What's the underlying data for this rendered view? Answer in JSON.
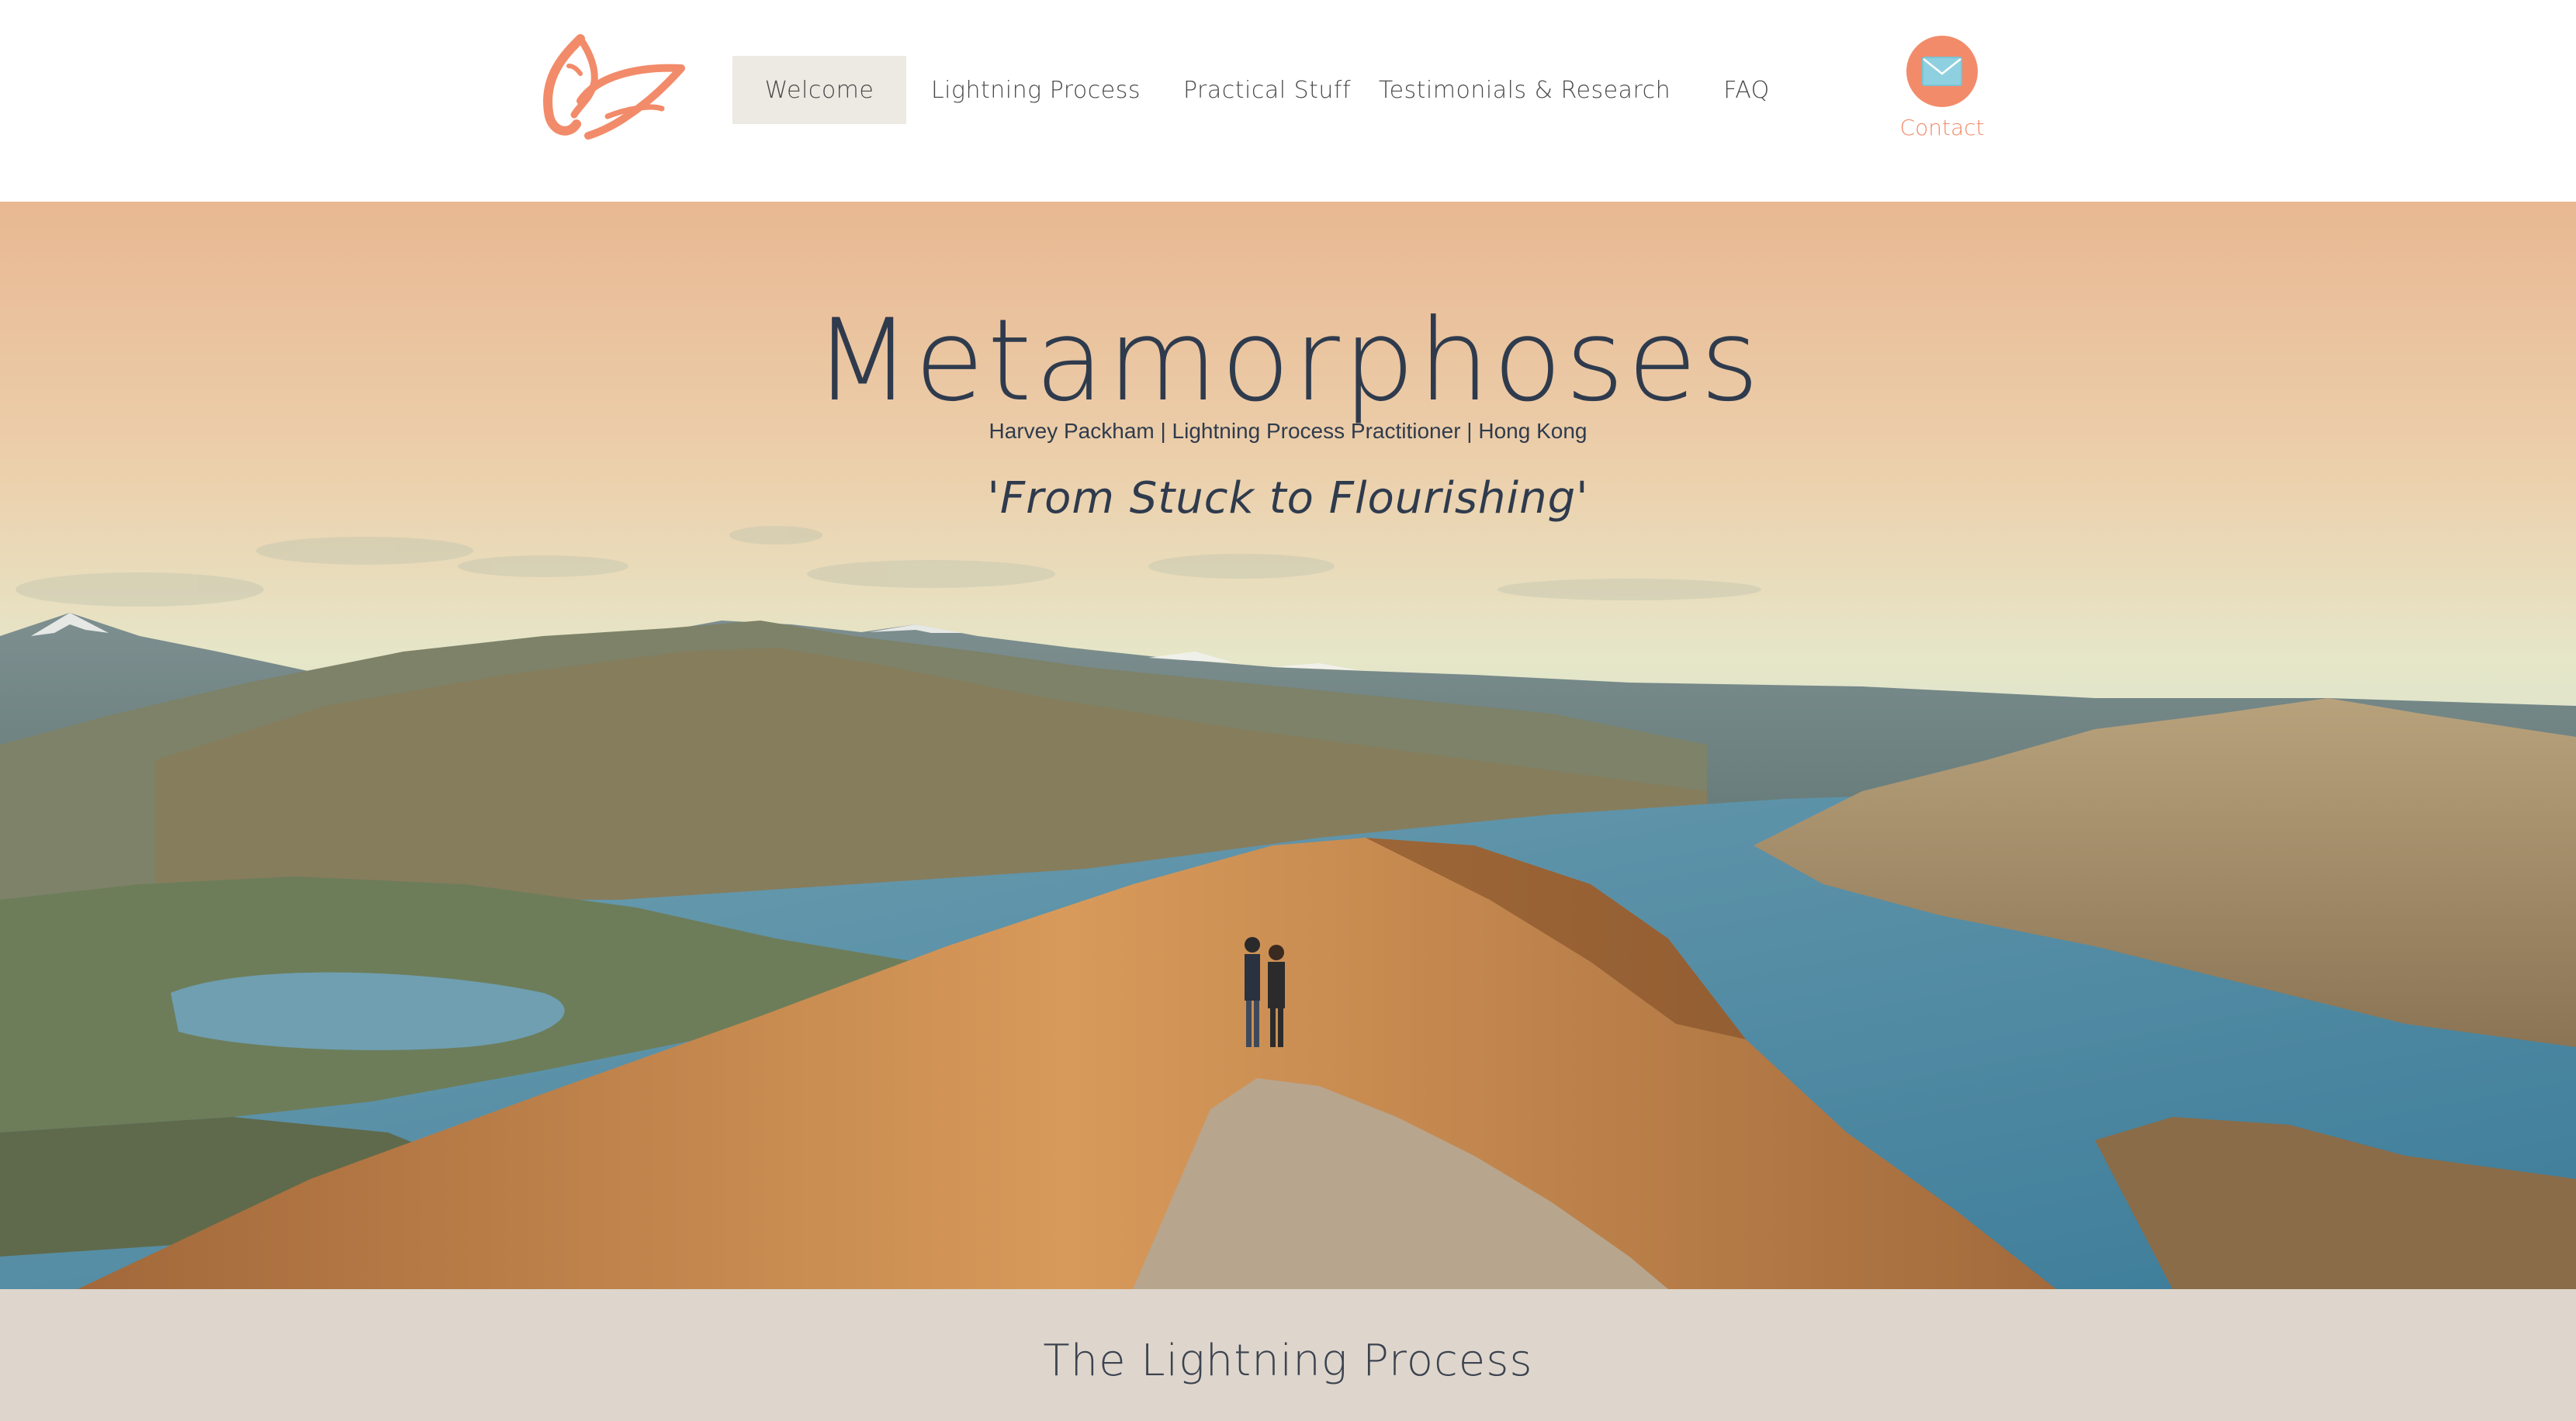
{
  "header": {
    "logo": {
      "icon": "butterfly-logo-icon",
      "color": "#f28b6a"
    },
    "nav": [
      {
        "label": "Welcome",
        "active": true
      },
      {
        "label": "Lightning Process",
        "active": false
      },
      {
        "label": "Practical Stuff",
        "active": false
      },
      {
        "label": "Testimonials & Research",
        "active": false
      },
      {
        "label": "FAQ",
        "active": false
      }
    ],
    "contact": {
      "label": "Contact",
      "icon": "envelope-icon",
      "color": "#f28b6a"
    }
  },
  "hero": {
    "title": "Metamorphoses",
    "subtitle": "Harvey Packham | Lightning Process Practitioner | Hong Kong",
    "tagline": "'From Stuck to Flourishing'",
    "background": "mountain-lake-landscape-with-couple"
  },
  "section": {
    "title": "The Lightning Process",
    "background_color": "#ded6cc"
  }
}
